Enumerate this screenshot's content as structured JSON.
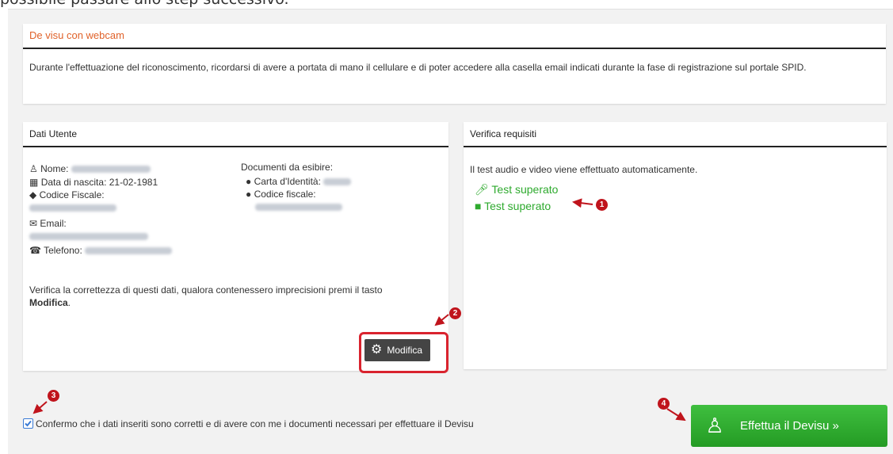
{
  "top_text": "possibile passare allo step successivo.",
  "webcam_panel": {
    "title": "De visu con webcam",
    "text": "Durante l'effettuazione del riconoscimento, ricordarsi di avere a portata di mano il cellulare e di poter accedere alla casella email indicati durante la fase di registrazione sul portale SPID."
  },
  "user_panel": {
    "title": "Dati Utente",
    "nome_label": "Nome:",
    "data_label": "Data di nascita:",
    "data_value": "21-02-1981",
    "cf_label": "Codice Fiscale:",
    "email_label": "Email:",
    "tel_label": "Telefono:",
    "docs_title": "Documenti da esibire:",
    "doc1_label": "Carta d'Identità:",
    "doc2_label": "Codice fiscale:",
    "verify_text": "Verifica la correttezza di questi dati, qualora contenessero imprecisioni premi il tasto ",
    "verify_bold": "Modifica",
    "verify_end": ".",
    "modify_button": "Modifica"
  },
  "requirements_panel": {
    "title": "Verifica requisiti",
    "info": "Il test audio e video viene effettuato automaticamente.",
    "audio_test": "Test superato",
    "video_test": "Test superato"
  },
  "confirm": {
    "text": "Confermo che i dati inseriti sono corretti e di avere con me i documenti necessari per effettuare il Devisu",
    "checked": true
  },
  "devisu_button": "Effettua il Devisu »",
  "badges": [
    "1",
    "2",
    "3",
    "4"
  ],
  "colors": {
    "accent_orange": "#e0622a",
    "success_green": "#2eaa2e",
    "annotation_red": "#c0141c",
    "button_green": "#2fae2f"
  }
}
